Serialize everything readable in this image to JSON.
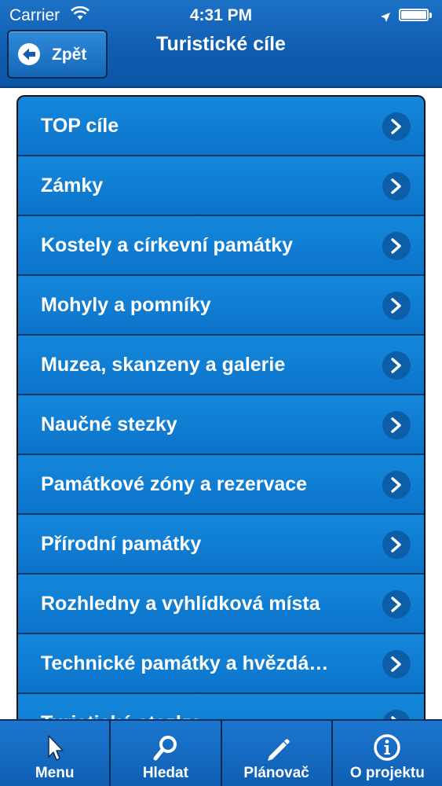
{
  "status_bar": {
    "carrier": "Carrier",
    "time": "4:31 PM"
  },
  "nav": {
    "back_label": "Zpět",
    "title": "Turistické cíle"
  },
  "list": {
    "items": [
      {
        "label": "TOP cíle"
      },
      {
        "label": "Zámky"
      },
      {
        "label": "Kostely a církevní památky"
      },
      {
        "label": "Mohyly a pomníky"
      },
      {
        "label": "Muzea, skanzeny a galerie"
      },
      {
        "label": "Naučné stezky"
      },
      {
        "label": "Památkové zóny a rezervace"
      },
      {
        "label": "Přírodní památky"
      },
      {
        "label": "Rozhledny a vyhlídková místa"
      },
      {
        "label": "Technické památky a hvězdá…"
      },
      {
        "label": "Turistické stezky"
      }
    ]
  },
  "tabbar": {
    "tabs": [
      {
        "label": "Menu",
        "icon": "cursor-icon"
      },
      {
        "label": "Hledat",
        "icon": "magnifier-icon"
      },
      {
        "label": "Plánovač",
        "icon": "pencil-icon"
      },
      {
        "label": "O projektu",
        "icon": "info-icon"
      }
    ]
  },
  "colors": {
    "header_blue": "#0f5cb0",
    "row_blue": "#0f79cf",
    "text": "#ffffff"
  }
}
